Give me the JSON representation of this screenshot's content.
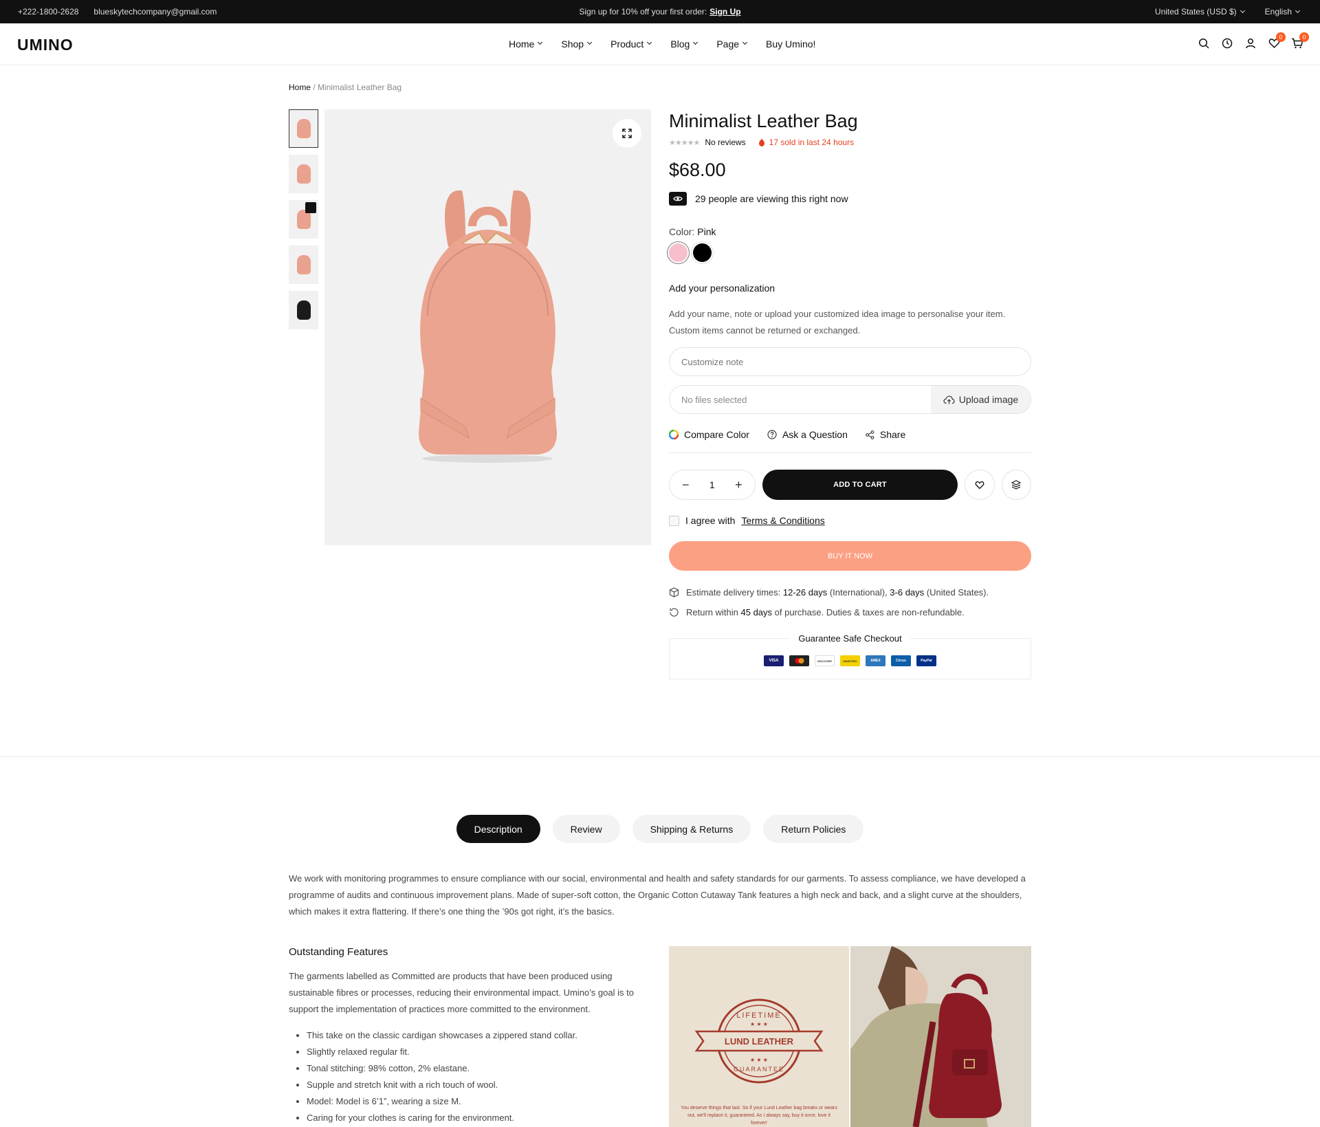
{
  "topbar": {
    "phone": "+222-1800-2628",
    "email": "blueskytechcompany@gmail.com",
    "promo": "Sign up for 10% off your first order:",
    "promo_link": "Sign Up",
    "currency": "United States (USD $)",
    "language": "English"
  },
  "header": {
    "logo": "UMINO",
    "nav": [
      "Home",
      "Shop",
      "Product",
      "Blog",
      "Page",
      "Buy Umino!"
    ],
    "wishlist_count": "0",
    "cart_count": "0"
  },
  "breadcrumb": {
    "home": "Home",
    "current": "Minimalist Leather Bag"
  },
  "product": {
    "title": "Minimalist Leather Bag",
    "reviews": "No reviews",
    "sold": "17 sold in last 24 hours",
    "price": "$68.00",
    "viewing": "29 people are viewing this right now",
    "color_label": "Color:",
    "color_value": "Pink",
    "colors": [
      "#f6bfcb",
      "#000000"
    ],
    "perso_title": "Add your personalization",
    "perso_desc_1": "Add your name, note or upload your customized idea image to personalise your item.",
    "perso_desc_2": "Custom items cannot be returned or exchanged.",
    "note_placeholder": "Customize note",
    "no_files": "No files selected",
    "upload_label": "Upload image",
    "compare_color": "Compare Color",
    "ask_question": "Ask a Question",
    "share": "Share",
    "quantity": "1",
    "add_to_cart": "ADD TO CART",
    "agree_text": "I agree with",
    "terms": "Terms & Conditions",
    "buy_now": "BUY IT NOW",
    "delivery_prefix": "Estimate delivery times:",
    "delivery_intl": "12-26 days",
    "delivery_intl_suffix": "(International),",
    "delivery_us": "3-6 days",
    "delivery_us_suffix": "(United States).",
    "return_prefix": "Return within",
    "return_days": "45 days",
    "return_suffix": "of purchase. Duties & taxes are non-refundable.",
    "guarantee": "Guarantee Safe Checkout",
    "payments": [
      "VISA",
      "MC",
      "DISCOVER",
      "MAESTRO",
      "AMEX",
      "Cirrus",
      "PayPal"
    ]
  },
  "tabs": [
    "Description",
    "Review",
    "Shipping & Returns",
    "Return Policies"
  ],
  "description": {
    "intro": "We work with monitoring programmes to ensure compliance with our social, environmental and health and safety standards for our garments. To assess compliance, we have developed a programme of audits and continuous improvement plans. Made of super-soft cotton, the Organic Cotton Cutaway Tank features a high neck and back, and a slight curve at the shoulders, which makes it extra flattering. If there’s one thing the ’90s got right, it’s the basics.",
    "features_title": "Outstanding Features",
    "features_desc": "The garments labelled as Committed are products that have been produced using sustainable fibres or processes, reducing their environmental impact. Umino’s goal is to support the implementation of practices more committed to the environment.",
    "features": [
      "This take on the classic cardigan showcases a zippered stand collar.",
      "Slightly relaxed regular fit.",
      "Tonal stitching: 98% cotton, 2% elastane.",
      "Supple and stretch knit with a rich touch of wool.",
      "Model: Model is 6’1”, wearing a size M.",
      "Caring for your clothes is caring for the environment."
    ],
    "lund_line1": "LIFETIME",
    "lund_line2": "LUND LEATHER",
    "lund_line3": "GUARANTEE",
    "lund_text": "You deserve things that last. So if your Lund Leather bag breaks or wears out, we'll replace it, guaranteed. As I always say, buy it once, love it forever!"
  }
}
